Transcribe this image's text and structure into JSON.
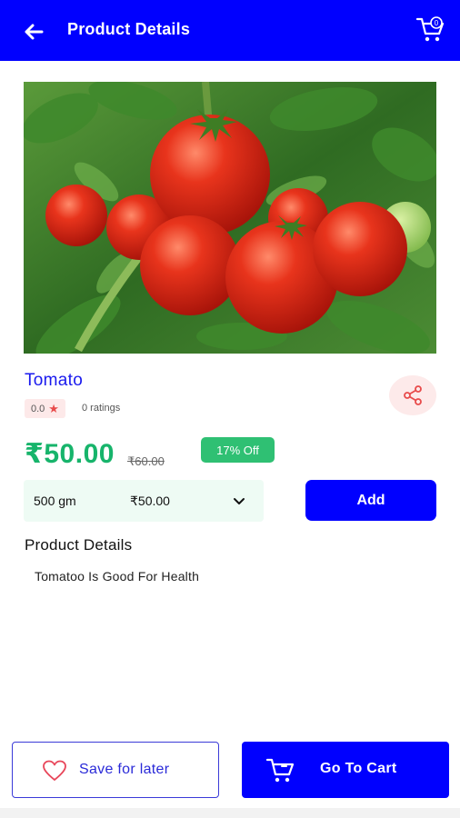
{
  "header": {
    "title": "Product Details",
    "back_icon": "arrow-left-icon",
    "cart_icon": "cart-icon",
    "cart_count": "0"
  },
  "product": {
    "image_alt": "tomatoes",
    "name": "Tomato",
    "rating": "0.0",
    "ratings_count": "0 ratings",
    "price": "₹50.00",
    "mrp": "₹60.00",
    "discount": "17% Off",
    "variant": {
      "weight": "500 gm",
      "price": "₹50.00"
    },
    "add_label": "Add"
  },
  "details": {
    "title": "Product Details",
    "description": "Tomatoo Is Good For Health"
  },
  "footer": {
    "save_label": "Save for later",
    "cart_label": "Go To Cart"
  },
  "colors": {
    "primary": "#0000ff",
    "price_green": "#17b46b",
    "badge_green": "#2fc073",
    "star_red": "#e84b4b"
  }
}
